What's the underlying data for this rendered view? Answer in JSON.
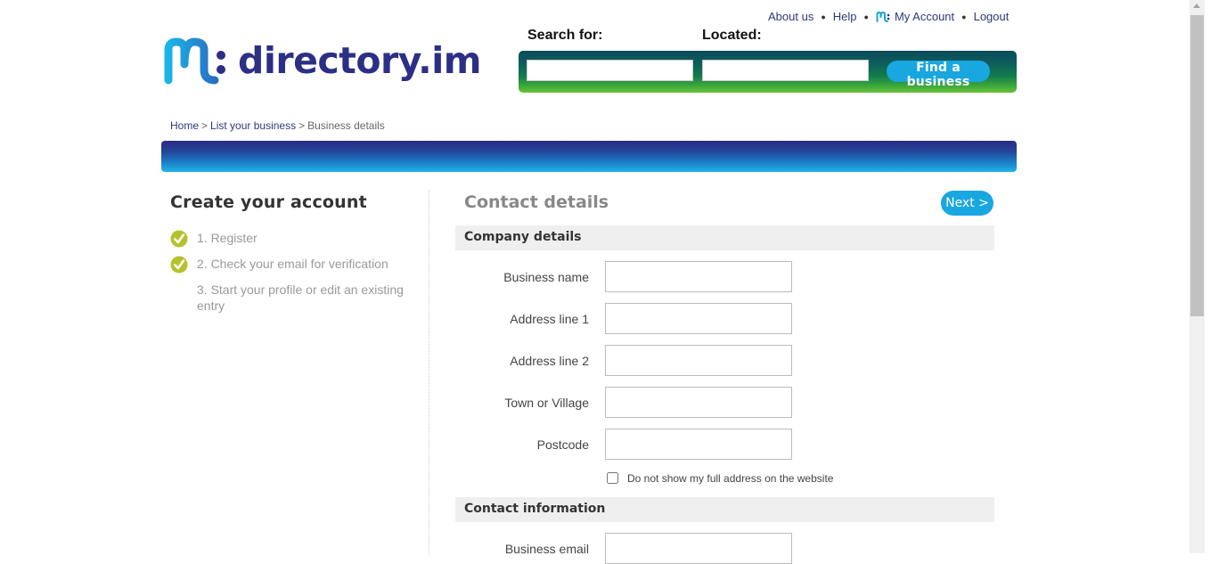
{
  "header": {
    "links": [
      {
        "label": "About us"
      },
      {
        "label": "Help"
      },
      {
        "label": "My Account"
      },
      {
        "label": "Logout"
      }
    ],
    "logo_text": "directory.im"
  },
  "search": {
    "search_for_label": "Search for:",
    "located_label": "Located:",
    "search_for_value": "",
    "located_value": "",
    "button_label": "Find a business"
  },
  "breadcrumb": {
    "home": "Home",
    "list": "List your business",
    "current": "Business details",
    "separator": ">"
  },
  "left_panel": {
    "title": "Create your account",
    "steps": [
      {
        "label": "1. Register",
        "done": true
      },
      {
        "label": "2. Check your email for verification",
        "done": true
      },
      {
        "label": "3. Start your profile or edit an existing entry",
        "done": false
      }
    ]
  },
  "form": {
    "title": "Contact details",
    "next_label": "Next >",
    "company_section": "Company details",
    "fields": [
      {
        "label": "Business name",
        "value": ""
      },
      {
        "label": "Address line 1",
        "value": ""
      },
      {
        "label": "Address line 2",
        "value": ""
      },
      {
        "label": "Town or Village",
        "value": ""
      },
      {
        "label": "Postcode",
        "value": ""
      }
    ],
    "hide_address_label": "Do not show my full address on the website",
    "hide_address_checked": false,
    "contact_section": "Contact information",
    "contact_fields": [
      {
        "label": "Business email",
        "value": ""
      }
    ]
  },
  "colors": {
    "brand_blue": "#2b2f86",
    "accent_cyan": "#19a7e0",
    "check_green": "#b5c22b"
  },
  "icons": [
    "directory-logo-icon",
    "mini-logo-icon",
    "checkmark-icon"
  ]
}
